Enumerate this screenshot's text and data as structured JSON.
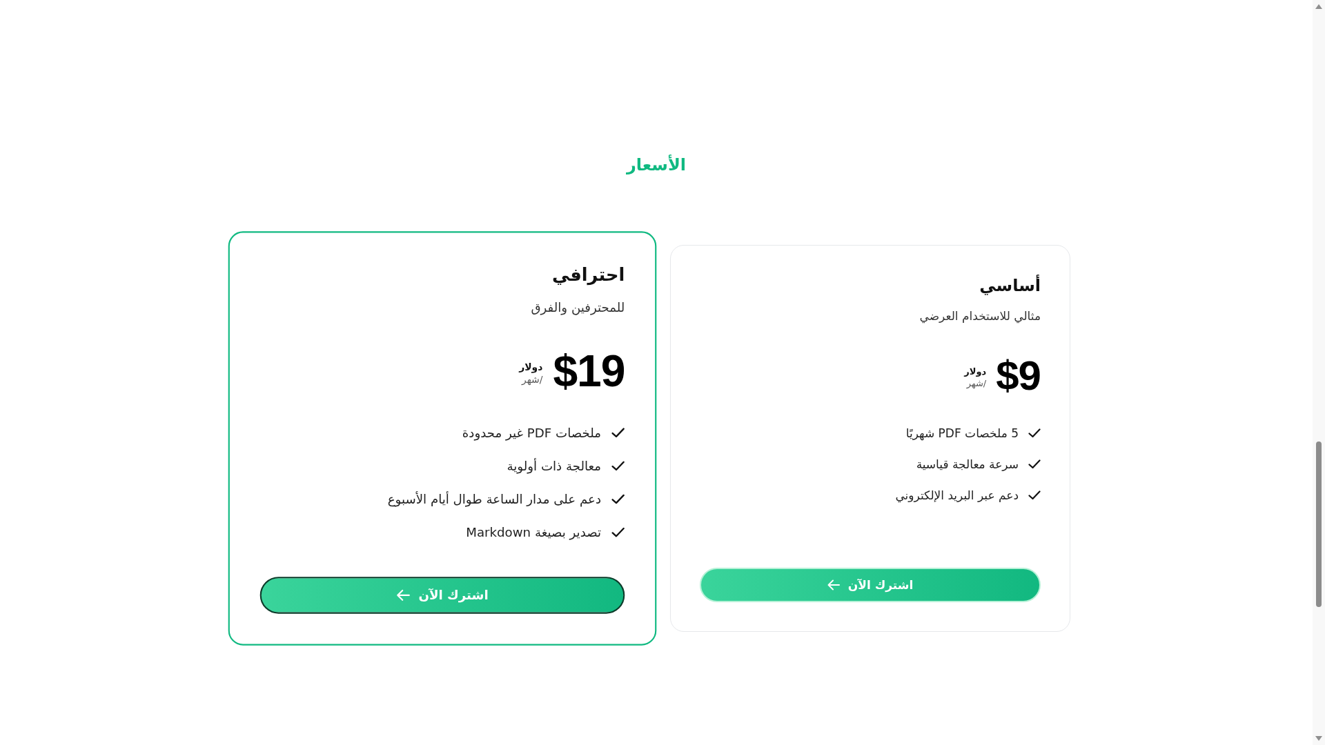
{
  "section": {
    "title": "الأسعار"
  },
  "plans": [
    {
      "name": "أساسي",
      "description": "مثالي للاستخدام العرضي",
      "price": "$9",
      "currency": "دولار",
      "period": "/شهر",
      "featured": false,
      "features": [
        "5 ملخصات PDF شهريًا",
        "سرعة معالجة قياسية",
        "دعم عبر البريد الإلكتروني"
      ],
      "button": "اشترك الآن"
    },
    {
      "name": "احترافي",
      "description": "للمحترفين والفرق",
      "price": "$19",
      "currency": "دولار",
      "period": "/شهر",
      "featured": true,
      "features": [
        "ملخصات PDF غير محدودة",
        "معالجة ذات أولوية",
        "دعم على مدار الساعة طوال أيام الأسبوع",
        "تصدير بصيغة Markdown"
      ],
      "button": "اشترك الآن"
    }
  ]
}
